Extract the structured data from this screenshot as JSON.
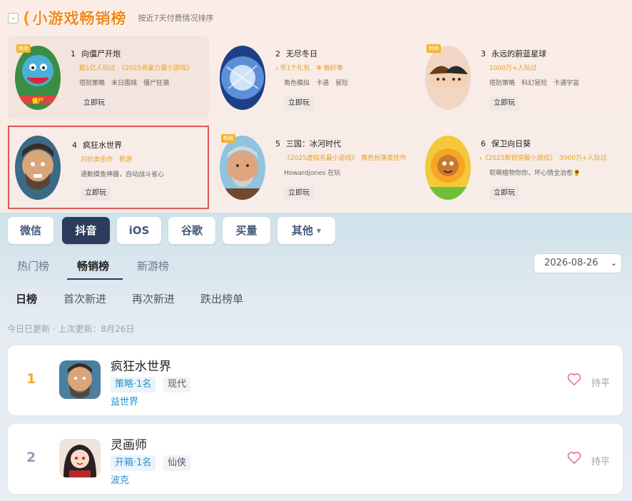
{
  "header": {
    "brand": "小游戏畅销榜",
    "subtitle": "按近7天付费情况排序"
  },
  "top_games": [
    {
      "rank": "1",
      "name": "向僵尸开炮",
      "badge": "畅销",
      "tags1": "超1亿人玩过　《2025肖豪力量小游戏》",
      "tags2": "塔防策略　末日围城　僵尸狂潮",
      "play": "立即玩"
    },
    {
      "rank": "2",
      "name": "无尽冬日",
      "badge": "",
      "tags1": "₃ 币1个礼包　❁ 做好事",
      "tags2": "角色模拟　卡通　冒险",
      "play": "立即玩"
    },
    {
      "rank": "3",
      "name": "永远的蔚蓝星球",
      "badge": "畅销",
      "tags1": "1000万+人玩过",
      "tags2": "塔防策略　科幻冒险　卡通宇宙",
      "play": "立即玩"
    },
    {
      "rank": "4",
      "name": "疯狂水世界",
      "badge": "",
      "tags1": "对抗类佳作　新游",
      "tags2": "通勤摸鱼神器，自动战斗省心",
      "play": "立即玩"
    },
    {
      "rank": "5",
      "name": "三国：冰河时代",
      "badge": "畅销",
      "tags1": "《2025虚拟名最小游戏》　角色扮演类佳作",
      "tags2": "Howardjones 在玩",
      "play": "立即玩"
    },
    {
      "rank": "6",
      "name": "保卫向日葵",
      "badge": "",
      "tags1": "₄《2025新锐突破小游戏》　3000万+人玩过",
      "tags2": "软萌植物你你，坏心情全治愈🌻",
      "play": "立即玩"
    }
  ],
  "platform_tabs": [
    "微信",
    "抖音",
    "iOS",
    "谷歌",
    "买量",
    "其他"
  ],
  "active_platform": "抖音",
  "chart_tabs": [
    "热门榜",
    "畅销榜",
    "新游榜"
  ],
  "date": "2026-08-26",
  "day_tabs": [
    "日榜",
    "首次新进",
    "再次新进",
    "跌出榜单"
  ],
  "update_text": "今日已更新 · 上次更新：8月26日",
  "rows": [
    {
      "rank": "1",
      "rank_color": "#f0a73a",
      "name": "疯狂水世界",
      "tag1": "策略·1名",
      "tag2": "现代",
      "dev": "益世界",
      "trend": "持平"
    },
    {
      "rank": "2",
      "rank_color": "#8fa0b5",
      "name": "灵画师",
      "tag1": "开箱·1名",
      "tag2": "仙侠",
      "dev": "波克",
      "trend": "持平"
    }
  ]
}
